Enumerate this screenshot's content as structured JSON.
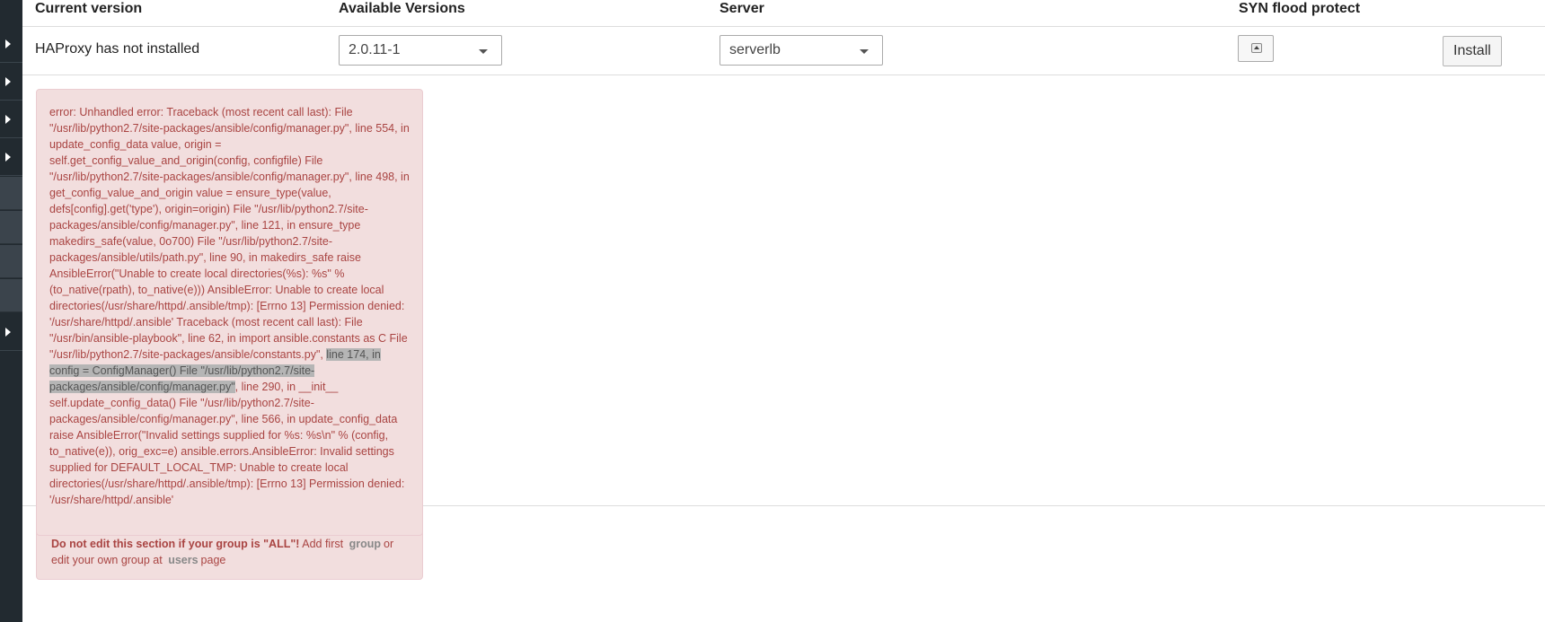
{
  "table": {
    "headers": {
      "current_version": "Current version",
      "available_versions": "Available Versions",
      "server": "Server",
      "syn_flood": "SYN flood protect"
    },
    "row": {
      "current_version": "HAProxy has not installed",
      "version_selected": "2.0.11-1",
      "server_selected": "serverlb",
      "install_label": "Install"
    }
  },
  "error": {
    "text_before": "error: Unhandled error: Traceback (most recent call last): File \"/usr/lib/python2.7/site-packages/ansible/config/manager.py\", line 554, in update_config_data value, origin = self.get_config_value_and_origin(config, configfile) File \"/usr/lib/python2.7/site-packages/ansible/config/manager.py\", line 498, in get_config_value_and_origin value = ensure_type(value, defs[config].get('type'), origin=origin) File \"/usr/lib/python2.7/site-packages/ansible/config/manager.py\", line 121, in ensure_type makedirs_safe(value, 0o700) File \"/usr/lib/python2.7/site-packages/ansible/utils/path.py\", line 90, in makedirs_safe raise AnsibleError(\"Unable to create local directories(%s): %s\" % (to_native(rpath), to_native(e))) AnsibleError: Unable to create local directories(/usr/share/httpd/.ansible/tmp): [Errno 13] Permission denied: '/usr/share/httpd/.ansible' Traceback (most recent call last): File \"/usr/bin/ansible-playbook\", line 62, in import ansible.constants as C File \"/usr/lib/python2.7/site-packages/ansible/constants.py\", ",
    "text_selected": "line 174, in config = ConfigManager() File \"/usr/lib/python2.7/site-packages/ansible/config/manager.py\"",
    "text_after": ", line 290, in __init__ self.update_config_data() File \"/usr/lib/python2.7/site-packages/ansible/config/manager.py\", line 566, in update_config_data raise AnsibleError(\"Invalid settings supplied for %s: %s\\n\" % (config, to_native(e)), orig_exc=e) ansible.errors.AnsibleError: Invalid settings supplied for DEFAULT_LOCAL_TMP: Unable to create local directories(/usr/share/httpd/.ansible/tmp): [Errno 13] Permission denied: '/usr/share/httpd/.ansible'"
  },
  "note": {
    "bold": "Do not edit this section if your group is \"ALL\"!",
    "text1": "Add first",
    "group_link": "group",
    "text2": "or edit your own group at",
    "users_link": "users",
    "text3": "page"
  }
}
